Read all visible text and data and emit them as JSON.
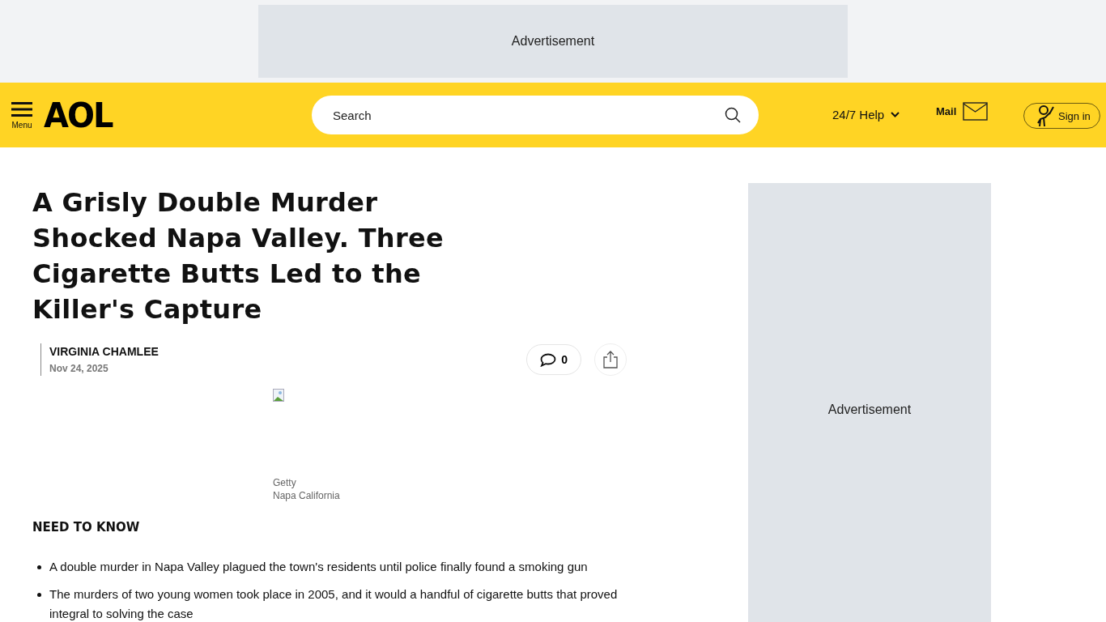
{
  "top_ad": {
    "label": "Advertisement"
  },
  "header": {
    "menu_label": "Menu",
    "logo": "AOL",
    "search": {
      "placeholder": "Search"
    },
    "help": "24/7 Help",
    "mail": "Mail",
    "sign_in": "Sign in"
  },
  "article": {
    "title": "A Grisly Double Murder Shocked Napa Valley. Three Cigarette Butts Led to the Killer's Capture",
    "author": "VIRGINIA CHAMLEE",
    "date": "Nov 24, 2025",
    "comments": "0",
    "image": {
      "credit": "Getty",
      "caption": "Napa California"
    },
    "section_heading": "NEED TO KNOW",
    "bullets": [
      "A double murder in Napa Valley plagued the town's residents until police finally found a smoking gun",
      "The murders of two young women took place in 2005, and it would a handful of cigarette butts that proved integral to solving the case"
    ]
  },
  "side_ad": {
    "label": "Advertisement"
  }
}
